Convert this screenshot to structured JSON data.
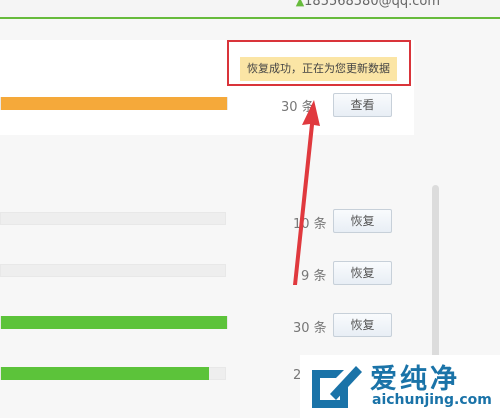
{
  "header": {
    "user_email": "185568580@qq.com"
  },
  "toast": {
    "message": "恢复成功，正在为您更新数据"
  },
  "top_row": {
    "count": "30 条",
    "action": "查看",
    "fill_fraction": 1.0,
    "color": "#f5a93a"
  },
  "rows": [
    {
      "count": "10 条",
      "action": "恢复",
      "fill_fraction": 0.0,
      "color": "#5cc33a"
    },
    {
      "count": "9 条",
      "action": "恢复",
      "fill_fraction": 0.0,
      "color": "#5cc33a"
    },
    {
      "count": "30 条",
      "action": "恢复",
      "fill_fraction": 1.0,
      "color": "#5cc33a"
    },
    {
      "count": "2",
      "action": "",
      "fill_fraction": 0.93,
      "color": "#5cc33a"
    }
  ],
  "watermark": {
    "brand": "爱纯净",
    "url": "aichunjing.com"
  },
  "colors": {
    "accent_green": "#67bb3c",
    "highlight_red": "#d9343a",
    "toast_bg": "#fbe5a5"
  }
}
